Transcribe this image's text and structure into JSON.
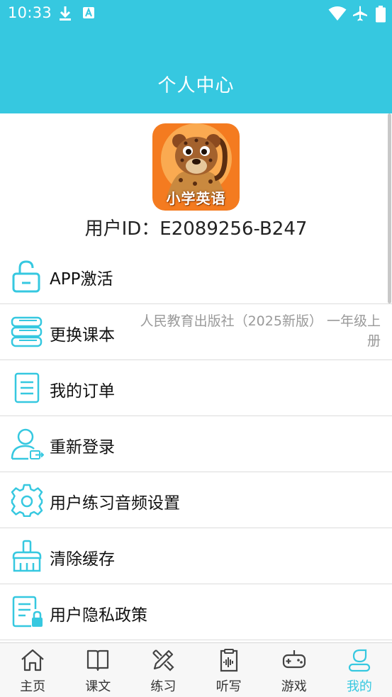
{
  "status_bar": {
    "time": "10:33"
  },
  "header": {
    "title": "个人中心"
  },
  "profile": {
    "logo_text": "小学英语",
    "user_id": "用户ID：E2089256-B247"
  },
  "menu": [
    {
      "label": "APP激活",
      "value": "",
      "icon": "unlock-icon"
    },
    {
      "label": "更换课本",
      "value": "人民教育出版社（2025新版） 一年级上册",
      "icon": "books-icon"
    },
    {
      "label": "我的订单",
      "value": "",
      "icon": "document-icon"
    },
    {
      "label": "重新登录",
      "value": "",
      "icon": "user-logout-icon"
    },
    {
      "label": "用户练习音频设置",
      "value": "",
      "icon": "gear-icon"
    },
    {
      "label": "清除缓存",
      "value": "",
      "icon": "broom-icon"
    },
    {
      "label": "用户隐私政策",
      "value": "",
      "icon": "privacy-doc-icon"
    }
  ],
  "tabs": [
    {
      "label": "主页",
      "icon": "home-icon",
      "active": false
    },
    {
      "label": "课文",
      "icon": "book-icon",
      "active": false
    },
    {
      "label": "练习",
      "icon": "pencil-icon",
      "active": false
    },
    {
      "label": "听写",
      "icon": "dictation-icon",
      "active": false
    },
    {
      "label": "游戏",
      "icon": "gamepad-icon",
      "active": false
    },
    {
      "label": "我的",
      "icon": "profile-icon",
      "active": true
    }
  ],
  "colors": {
    "accent": "#36c8e0",
    "logo_bg": "#f47b20"
  }
}
